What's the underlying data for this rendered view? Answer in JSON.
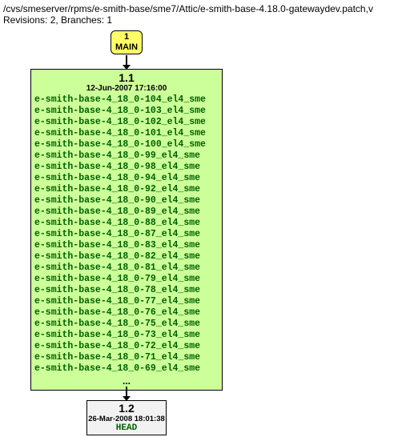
{
  "header": {
    "path": "/cvs/smeserver/rpms/e-smith-base/sme7/Attic/e-smith-base-4.18.0-gatewaydev.patch,v",
    "rev_line": "Revisions: 2, Branches: 1"
  },
  "main_branch": {
    "number": "1",
    "label": "MAIN"
  },
  "rev11": {
    "version": "1.1",
    "date": "12-Jun-2007 17:16:00",
    "tags": [
      "e-smith-base-4_18_0-104_el4_sme",
      "e-smith-base-4_18_0-103_el4_sme",
      "e-smith-base-4_18_0-102_el4_sme",
      "e-smith-base-4_18_0-101_el4_sme",
      "e-smith-base-4_18_0-100_el4_sme",
      "e-smith-base-4_18_0-99_el4_sme",
      "e-smith-base-4_18_0-98_el4_sme",
      "e-smith-base-4_18_0-94_el4_sme",
      "e-smith-base-4_18_0-92_el4_sme",
      "e-smith-base-4_18_0-90_el4_sme",
      "e-smith-base-4_18_0-89_el4_sme",
      "e-smith-base-4_18_0-88_el4_sme",
      "e-smith-base-4_18_0-87_el4_sme",
      "e-smith-base-4_18_0-83_el4_sme",
      "e-smith-base-4_18_0-82_el4_sme",
      "e-smith-base-4_18_0-81_el4_sme",
      "e-smith-base-4_18_0-79_el4_sme",
      "e-smith-base-4_18_0-78_el4_sme",
      "e-smith-base-4_18_0-77_el4_sme",
      "e-smith-base-4_18_0-76_el4_sme",
      "e-smith-base-4_18_0-75_el4_sme",
      "e-smith-base-4_18_0-73_el4_sme",
      "e-smith-base-4_18_0-72_el4_sme",
      "e-smith-base-4_18_0-71_el4_sme",
      "e-smith-base-4_18_0-69_el4_sme"
    ],
    "ellipsis": "..."
  },
  "rev12": {
    "version": "1.2",
    "date": "26-Mar-2008 18:01:38",
    "head": "HEAD"
  }
}
